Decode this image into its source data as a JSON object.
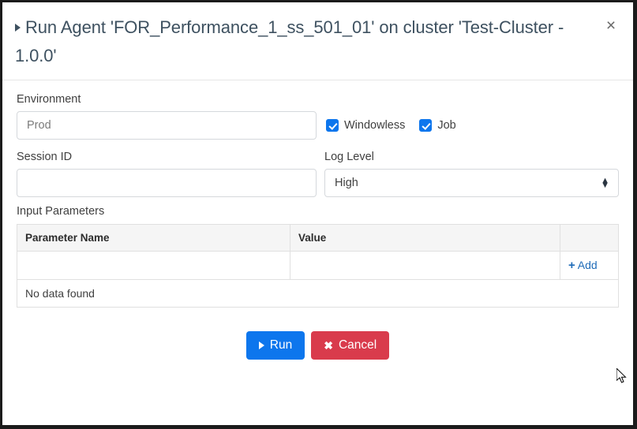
{
  "window": {
    "modal": {
      "title": "Run Agent 'FOR_Performance_1_ss_501_01' on cluster 'Test-Cluster - 1.0.0'",
      "caret_icon": "caret-right-icon",
      "close_icon": "close-icon",
      "close_label": "×"
    },
    "form": {
      "environment": {
        "label": "Environment",
        "value": "",
        "placeholder": "Prod"
      },
      "checkboxes": [
        {
          "label": "Windowless",
          "checked": true
        },
        {
          "label": "Job",
          "checked": true
        }
      ],
      "session_id": {
        "label": "Session ID",
        "value": "",
        "placeholder": ""
      },
      "log_level": {
        "label": "Log Level",
        "selected": "High",
        "options": [
          "High"
        ],
        "stepper_up": "▲",
        "stepper_down": "▼"
      }
    },
    "parameters": {
      "section_label": "Input Parameters",
      "columns": [
        "Parameter Name",
        "Value",
        ""
      ],
      "rows": [
        {
          "name": "",
          "value": "",
          "action": "Add",
          "action_icon": "plus-icon"
        }
      ],
      "empty_message": "No data found"
    },
    "footer": {
      "run_label": "Run",
      "run_icon": "play-icon",
      "cancel_label": "Cancel",
      "cancel_icon": "x-icon"
    },
    "colors": {
      "primary_blue": "#0d76ed",
      "danger_red": "#d93b4c",
      "link_blue": "#1e6bb8",
      "title_text": "#3e5160",
      "border_grey": "#e0e0e0"
    }
  }
}
